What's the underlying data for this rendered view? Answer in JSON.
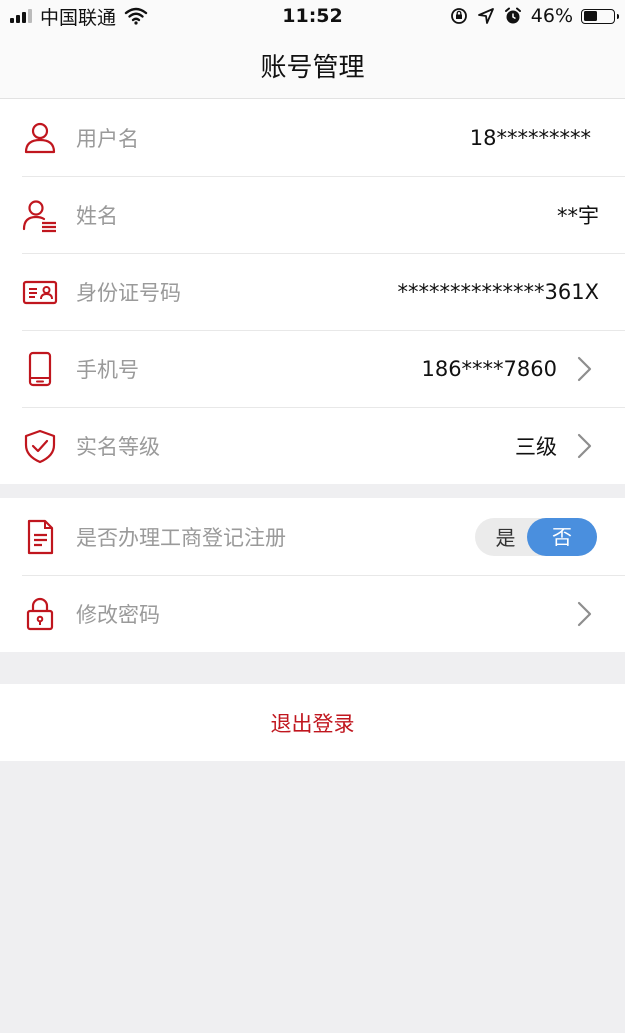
{
  "status_bar": {
    "carrier": "中国联通",
    "time": "11:52",
    "battery_percent": "46%",
    "battery_level": 0.46
  },
  "nav": {
    "title": "账号管理"
  },
  "account_rows": [
    {
      "label": "用户名",
      "value": "18*********",
      "icon": "user-icon"
    },
    {
      "label": "姓名",
      "value": "**宇",
      "icon": "user-list-icon"
    },
    {
      "label": "身份证号码",
      "value": "**************361X",
      "icon": "id-card-icon"
    },
    {
      "label": "手机号",
      "value": "186****7860",
      "icon": "phone-icon"
    },
    {
      "label": "实名等级",
      "value": "三级",
      "icon": "shield-check-icon"
    }
  ],
  "registration": {
    "label": "是否办理工商登记注册",
    "icon": "document-icon",
    "option_yes": "是",
    "option_no": "否",
    "selected": "否"
  },
  "password": {
    "label": "修改密码",
    "icon": "lock-icon"
  },
  "logout": {
    "label": "退出登录"
  },
  "colors": {
    "accent_red": "#c0161e",
    "toggle_blue": "#4a8fde"
  }
}
